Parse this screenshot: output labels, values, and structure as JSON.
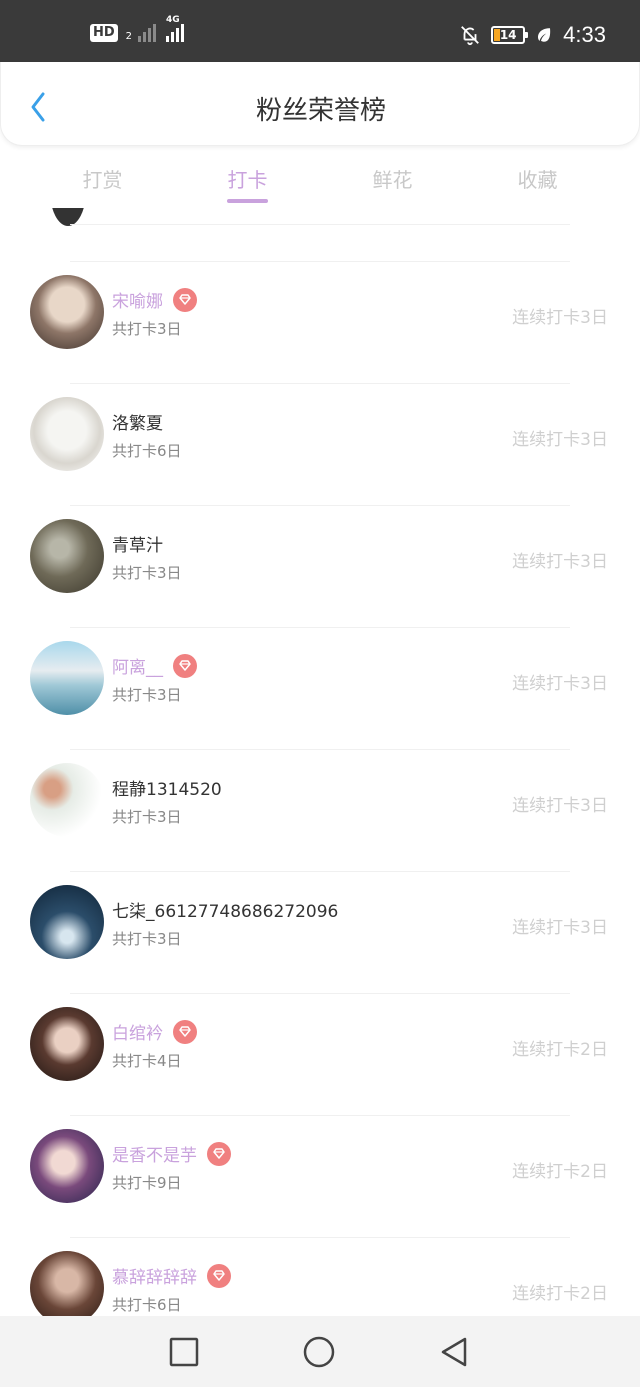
{
  "status_bar": {
    "hd_label": "HD",
    "hd_sub": "2",
    "network": "4G",
    "battery": "14",
    "time": "4:33",
    "icons": [
      "bell-off-icon",
      "battery-icon",
      "leaf-icon"
    ]
  },
  "header": {
    "title": "粉丝荣誉榜"
  },
  "tabs": [
    {
      "label": "打赏",
      "active": false
    },
    {
      "label": "打卡",
      "active": true
    },
    {
      "label": "鲜花",
      "active": false
    },
    {
      "label": "收藏",
      "active": false
    }
  ],
  "colors": {
    "accent": "#c9a2dd",
    "gem_badge": "#f08080",
    "status_bar": "#3a3a3a",
    "muted_text": "#cfcfcf"
  },
  "fans": [
    {
      "name": "宋喻娜",
      "vip": true,
      "total": "共打卡3日",
      "streak": "连续打卡3日"
    },
    {
      "name": "洛繁夏",
      "vip": false,
      "total": "共打卡6日",
      "streak": "连续打卡3日"
    },
    {
      "name": "青草汁",
      "vip": false,
      "total": "共打卡3日",
      "streak": "连续打卡3日"
    },
    {
      "name": "阿离__",
      "vip": true,
      "total": "共打卡3日",
      "streak": "连续打卡3日"
    },
    {
      "name": "程静1314520",
      "vip": false,
      "total": "共打卡3日",
      "streak": "连续打卡3日"
    },
    {
      "name": "七柒_66127748686272096",
      "vip": false,
      "total": "共打卡3日",
      "streak": "连续打卡3日"
    },
    {
      "name": "白绾衿",
      "vip": true,
      "total": "共打卡4日",
      "streak": "连续打卡2日"
    },
    {
      "name": "是香不是芋",
      "vip": true,
      "total": "共打卡9日",
      "streak": "连续打卡2日"
    },
    {
      "name": "慕辞辞辞辞",
      "vip": true,
      "total": "共打卡6日",
      "streak": "连续打卡2日"
    }
  ],
  "nav_bar": {
    "icons": [
      "square-icon",
      "circle-home-icon",
      "triangle-back-icon"
    ]
  }
}
